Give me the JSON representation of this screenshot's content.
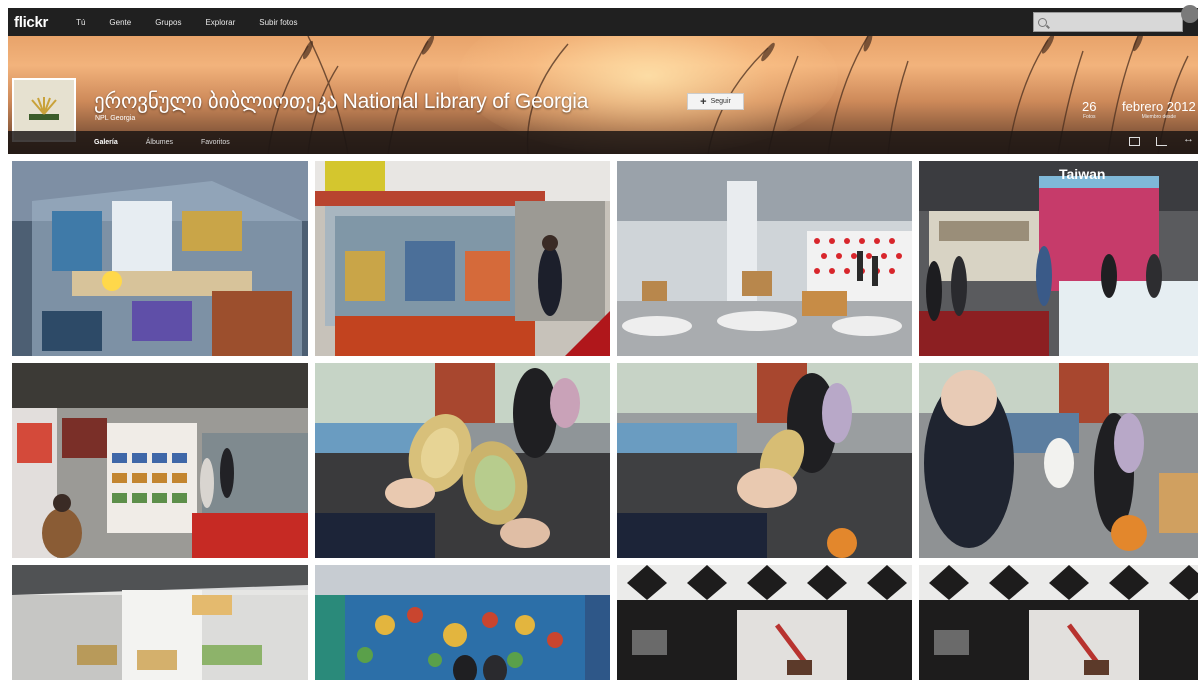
{
  "topnav": {
    "logo": "flickr",
    "items": [
      "Tú",
      "Gente",
      "Grupos",
      "Explorar",
      "Subir fotos"
    ],
    "search_placeholder": ""
  },
  "profile": {
    "name": "ეროვნული ბიბლიოთეკა National Library of Georgia",
    "subtitle": "NPL Georgia",
    "follow_label": "Seguir",
    "stats": [
      {
        "num": "26",
        "label": "Fotos"
      },
      {
        "num": "febrero 2012",
        "label": "Miembro desde"
      }
    ]
  },
  "tabs": [
    "Galería",
    "Álbumes",
    "Favoritos"
  ],
  "colors": {
    "topnav_bg": "#202020",
    "tab_bg": "#191412",
    "accent_red": "#c62828"
  },
  "photos": [
    {
      "name": "photo-display-case"
    },
    {
      "name": "photo-bookstand-red"
    },
    {
      "name": "photo-exhibit-hall-polkadot"
    },
    {
      "name": "photo-taiwan-booth"
    },
    {
      "name": "photo-bookshelves-aisle"
    },
    {
      "name": "photo-golden-books-1"
    },
    {
      "name": "photo-golden-books-2"
    },
    {
      "name": "photo-golden-books-3"
    },
    {
      "name": "photo-white-booth"
    },
    {
      "name": "photo-colorful-booth"
    },
    {
      "name": "photo-dark-booth-1"
    },
    {
      "name": "photo-dark-booth-2"
    }
  ]
}
